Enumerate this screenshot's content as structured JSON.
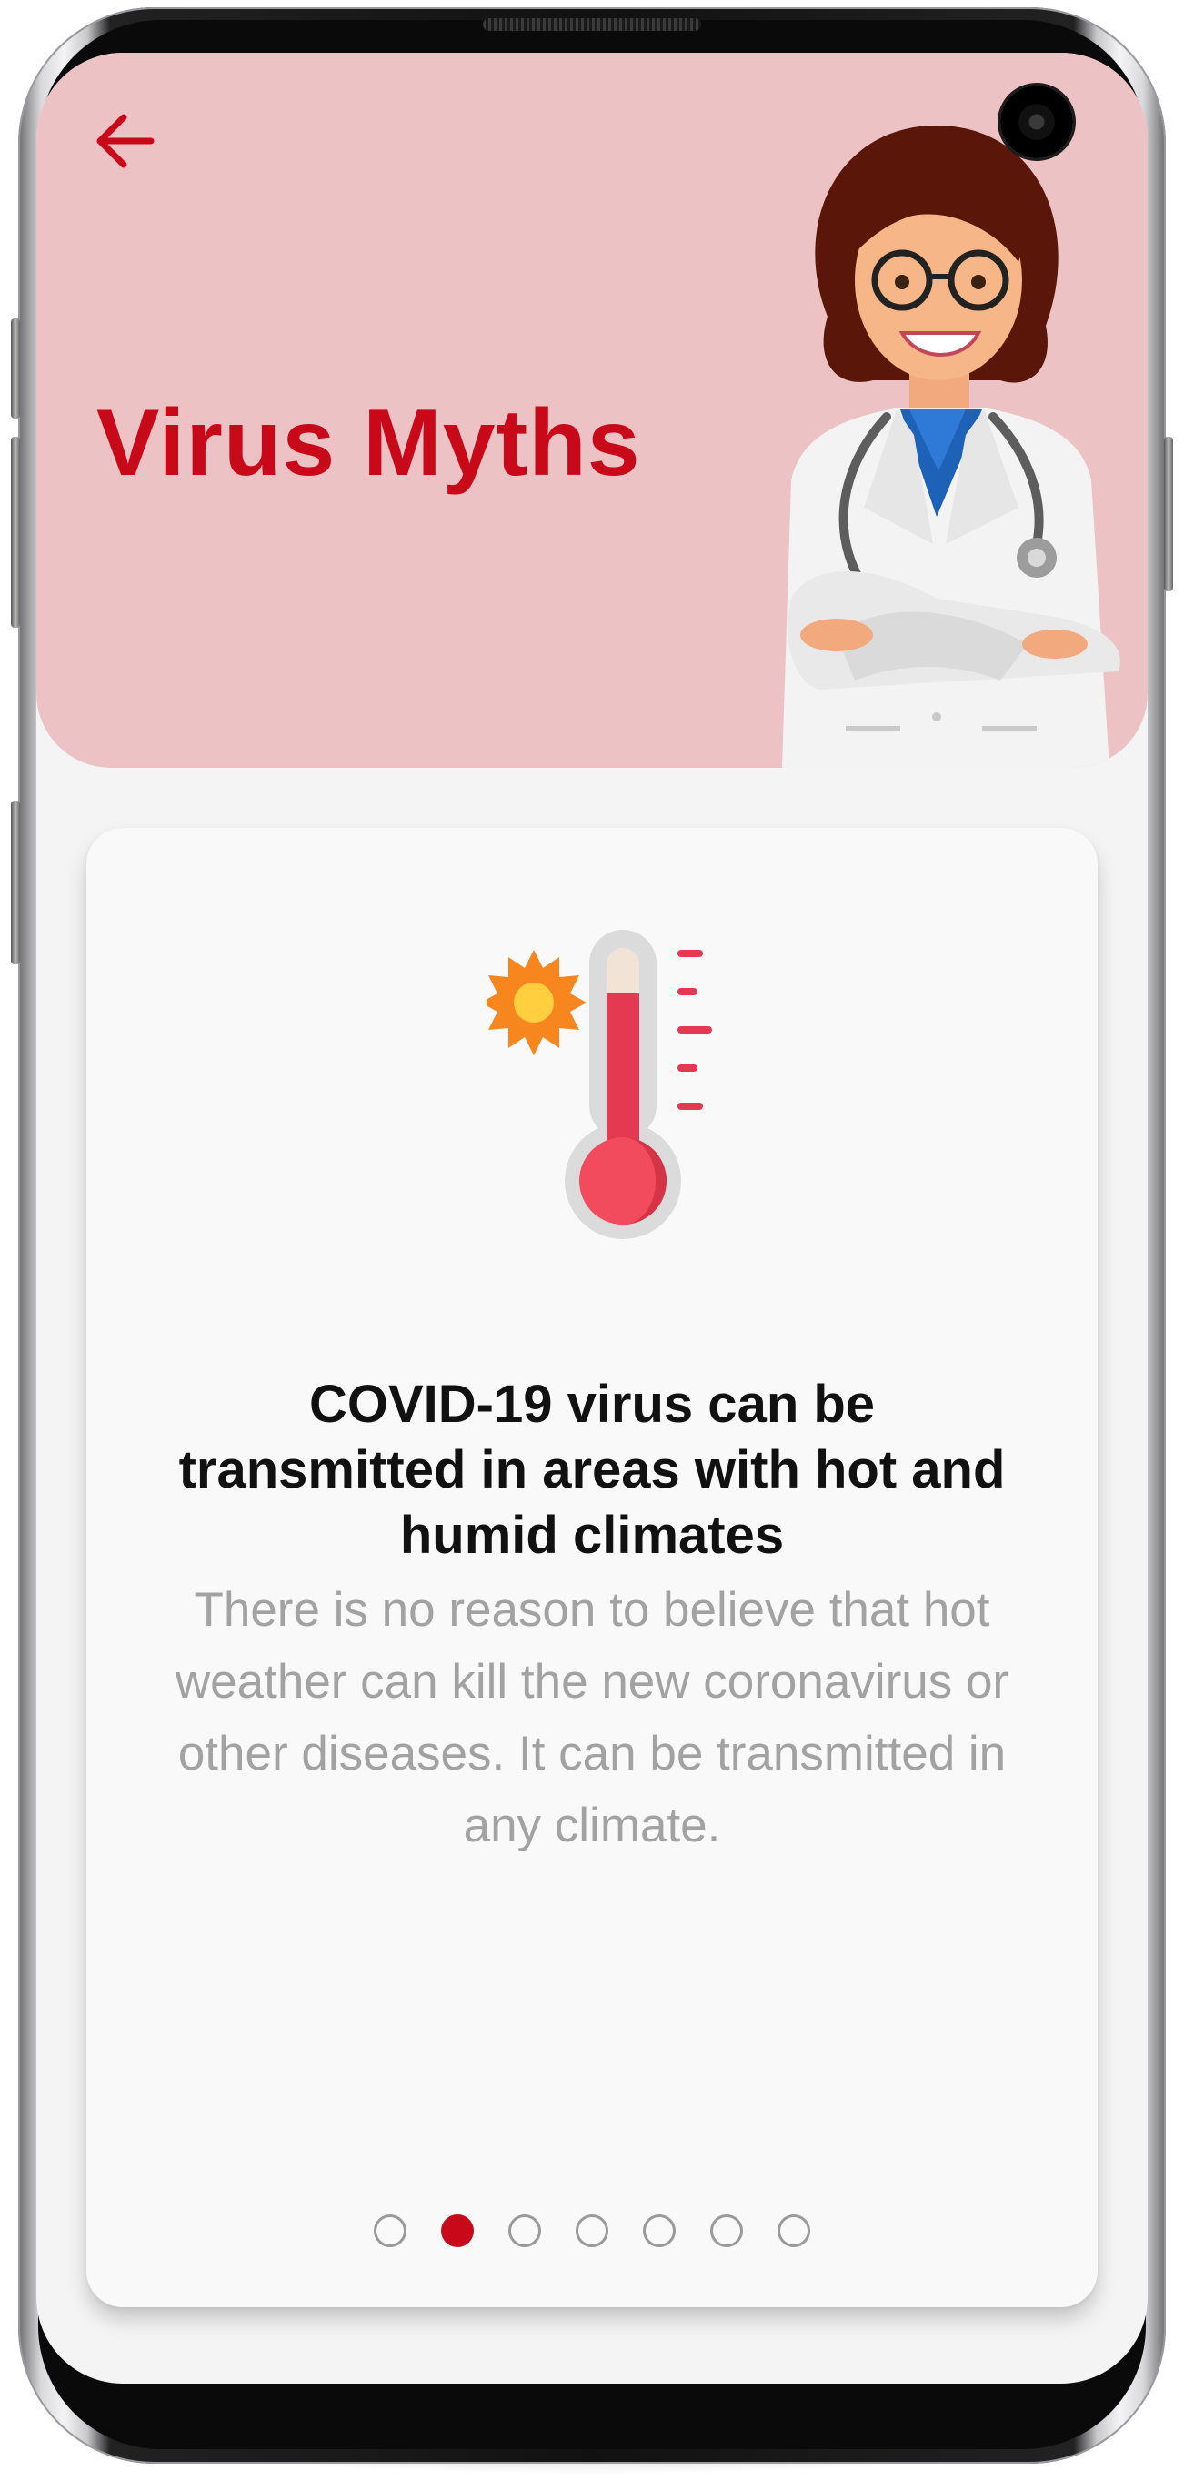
{
  "header": {
    "title": "Virus Myths",
    "back_icon": "arrow-left-icon",
    "background_color": "#ecc2c4",
    "accent_color": "#c8091a"
  },
  "card": {
    "illustration_icon": "thermometer-sun-icon",
    "myth_title": "COVID-19 virus can be transmitted in areas with hot and humid climates",
    "myth_body": "There is no reason to believe that hot weather can kill the new coronavirus or other diseases. It can be transmitted in any climate."
  },
  "pager": {
    "total": 7,
    "active_index": 1,
    "active_color": "#c8091a",
    "inactive_color": "#9a9a9a"
  }
}
